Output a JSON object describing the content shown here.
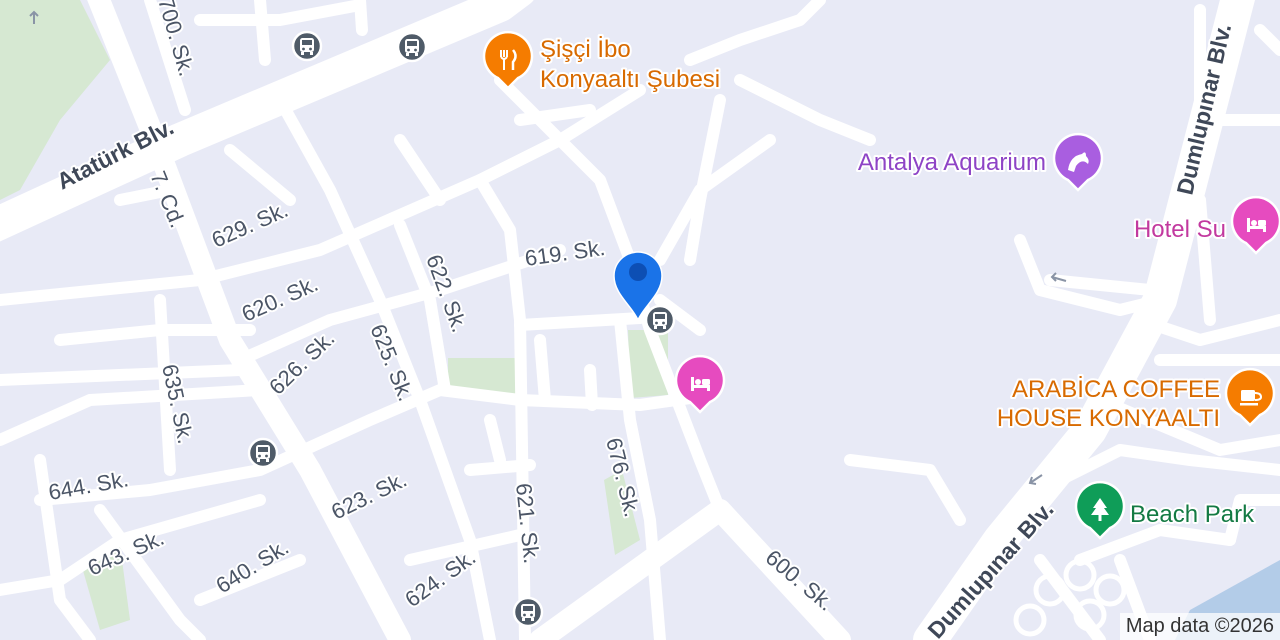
{
  "map": {
    "attribution": "Map data ©2026",
    "colors": {
      "background": "#e8eaf6",
      "road": "#ffffff",
      "park": "#d6e8d2",
      "water": "#b3cce8",
      "bus_stop": "#4f5b68",
      "restaurant": "#f57c00",
      "attraction": "#a95ee0",
      "hotel": "#e64bbf",
      "cafe": "#f57c00",
      "park_pin": "#0f9d58",
      "location_pin": "#1a73e8"
    },
    "roads": {
      "ataturk": "Atatürk Blv.",
      "dumlupinar_top": "Dumlupınar Blv.",
      "dumlupinar_bottom": "Dumlupınar Blv.",
      "sk700": "700. Sk.",
      "cd7": "7. Cd.",
      "sk629": "629. Sk.",
      "sk620": "620. Sk.",
      "sk619": "619. Sk.",
      "sk622": "622. Sk.",
      "sk626": "626. Sk.",
      "sk625": "625. Sk.",
      "sk635": "635. Sk.",
      "sk644": "644. Sk.",
      "sk643": "643. Sk.",
      "sk640": "640. Sk.",
      "sk623": "623. Sk.",
      "sk624": "624. Sk.",
      "sk621": "621. Sk.",
      "sk676": "676. Sk.",
      "sk600": "600. Sk."
    },
    "pois": {
      "sisci_line1": "Şişçi İbo",
      "sisci_line2": "Konyaaltı Şubesi",
      "aquarium": "Antalya Aquarium",
      "hotel_su": "Hotel Su",
      "arabica_line1": "ARABİCA COFFEE",
      "arabica_line2": "HOUSE KONYAALTI",
      "beach_park": "Beach Park"
    },
    "icons": {
      "bus": "bus-stop-icon",
      "restaurant": "fork-knife-icon",
      "aquarium": "dolphin-icon",
      "hotel": "bed-icon",
      "cafe": "coffee-cup-icon",
      "park": "tree-icon",
      "location": "location-pin-icon"
    }
  }
}
